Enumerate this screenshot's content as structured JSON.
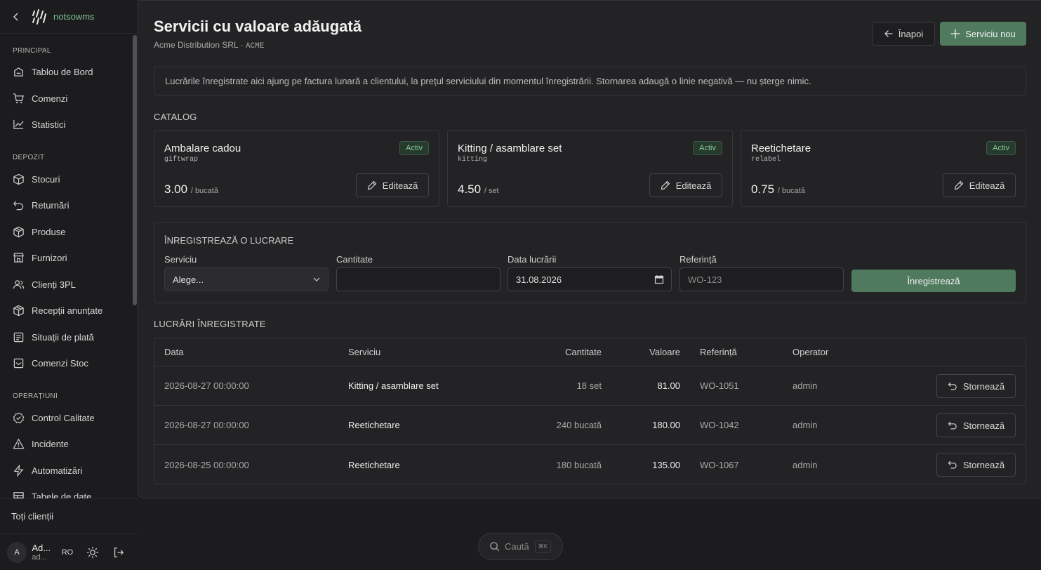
{
  "brand": {
    "name": "notsowms"
  },
  "sidebar": {
    "sections": [
      {
        "label": "PRINCIPAL",
        "items": [
          {
            "label": "Tablou de Bord",
            "icon": "home-icon"
          },
          {
            "label": "Comenzi",
            "icon": "cart-icon"
          },
          {
            "label": "Statistici",
            "icon": "chart-line-icon"
          }
        ]
      },
      {
        "label": "DEPOZIT",
        "items": [
          {
            "label": "Stocuri",
            "icon": "box-icon"
          },
          {
            "label": "Returnări",
            "icon": "undo-icon"
          },
          {
            "label": "Produse",
            "icon": "package-icon"
          },
          {
            "label": "Furnizori",
            "icon": "store-icon"
          },
          {
            "label": "Clienți 3PL",
            "icon": "users-icon"
          },
          {
            "label": "Recepții anunțate",
            "icon": "package-icon"
          },
          {
            "label": "Situații de plată",
            "icon": "receipt-icon"
          },
          {
            "label": "Comenzi Stoc",
            "icon": "inbox-icon"
          }
        ]
      },
      {
        "label": "OPERAȚIUNI",
        "items": [
          {
            "label": "Control Calitate",
            "icon": "badge-check-icon"
          },
          {
            "label": "Incidente",
            "icon": "warning-icon"
          },
          {
            "label": "Automatizări",
            "icon": "lightning-icon"
          },
          {
            "label": "Tabele de date",
            "icon": "table-icon"
          }
        ]
      }
    ],
    "all_clients": "Toți clienții",
    "user": {
      "initial": "A",
      "name": "Ad...",
      "email": "ad...",
      "lang": "RO"
    }
  },
  "header": {
    "title": "Servicii cu valoare adăugată",
    "company": "Acme Distribution SRL",
    "separator": "·",
    "company_code": "ACME",
    "back_label": "Înapoi",
    "new_label": "Serviciu nou"
  },
  "info": "Lucrările înregistrate aici ajung pe factura lunară a clientului, la prețul serviciului din momentul înregistrării. Stornarea adaugă o linie negativă — nu șterge nimic.",
  "catalog": {
    "heading": "CATALOG",
    "edit_label": "Editează",
    "cards": [
      {
        "title": "Ambalare cadou",
        "code": "giftwrap",
        "status": "Activ",
        "price": "3.00",
        "unit": "/ bucată"
      },
      {
        "title": "Kitting / asamblare set",
        "code": "kitting",
        "status": "Activ",
        "price": "4.50",
        "unit": "/ set"
      },
      {
        "title": "Reetichetare",
        "code": "relabel",
        "status": "Activ",
        "price": "0.75",
        "unit": "/ bucată"
      }
    ]
  },
  "form": {
    "heading": "ÎNREGISTREAZĂ O LUCRARE",
    "service_label": "Serviciu",
    "service_value": "Alege...",
    "qty_label": "Cantitate",
    "qty_value": "",
    "date_label": "Data lucrării",
    "date_value": "31.08.2026",
    "ref_label": "Referință",
    "ref_placeholder": "WO-123",
    "submit_label": "Înregistrează"
  },
  "works": {
    "heading": "LUCRĂRI ÎNREGISTRATE",
    "columns": {
      "date": "Data",
      "service": "Serviciu",
      "qty": "Cantitate",
      "value": "Valoare",
      "ref": "Referință",
      "operator": "Operator"
    },
    "storno_label": "Stornează",
    "rows": [
      {
        "date": "2026-08-27 00:00:00",
        "service": "Kitting / asamblare set",
        "qty": "18 set",
        "value": "81.00",
        "ref": "WO-1051",
        "operator": "admin"
      },
      {
        "date": "2026-08-27 00:00:00",
        "service": "Reetichetare",
        "qty": "240 bucată",
        "value": "180.00",
        "ref": "WO-1042",
        "operator": "admin"
      },
      {
        "date": "2026-08-25 00:00:00",
        "service": "Reetichetare",
        "qty": "180 bucată",
        "value": "135.00",
        "ref": "WO-1067",
        "operator": "admin"
      }
    ]
  },
  "search": {
    "placeholder": "Caută",
    "shortcut": "⌘K"
  },
  "colors": {
    "accent": "#4f7a5d",
    "brand": "#7fbf94",
    "badge": "#86c79a",
    "background": "#1c1c1e",
    "panel": "#232325"
  }
}
